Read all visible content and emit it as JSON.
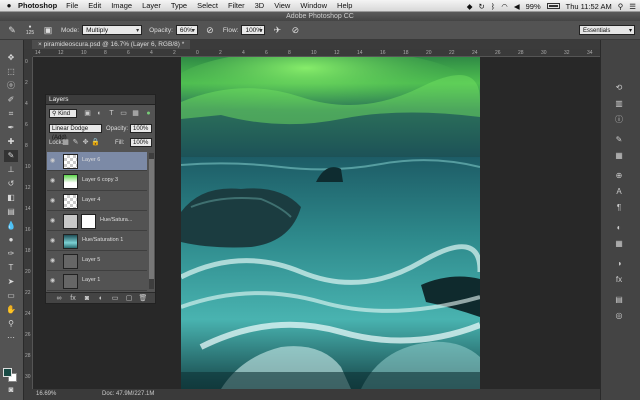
{
  "menubar": {
    "apple": "",
    "app": "Photoshop",
    "items": [
      "File",
      "Edit",
      "Image",
      "Layer",
      "Type",
      "Select",
      "Filter",
      "3D",
      "View",
      "Window",
      "Help"
    ],
    "battery": "99%",
    "clock": "Thu 11:52 AM"
  },
  "window": {
    "title": "Adobe Photoshop CC"
  },
  "options": {
    "brush_size": "125",
    "mode_label": "Mode:",
    "mode_value": "Multiply",
    "opacity_label": "Opacity:",
    "opacity_value": "60%",
    "flow_label": "Flow:",
    "flow_value": "100%",
    "workspace": "Essentials"
  },
  "document": {
    "tab": "piramideoscura.psd @ 16.7% (Layer 6, RGB/8) *",
    "zoom": "16.69%",
    "info": "Doc: 47.9M/227.1M"
  },
  "rulers": {
    "h_ticks": [
      "14",
      "12",
      "10",
      "8",
      "6",
      "4",
      "2",
      "0",
      "2",
      "4",
      "6",
      "8",
      "10",
      "12",
      "14",
      "16",
      "18",
      "20",
      "22",
      "24",
      "26",
      "28",
      "30",
      "32",
      "34"
    ],
    "v_ticks": [
      "0",
      "2",
      "4",
      "6",
      "8",
      "10",
      "12",
      "14",
      "16",
      "18",
      "20",
      "22",
      "24",
      "26",
      "28",
      "30"
    ]
  },
  "layers": {
    "panel_title": "Layers",
    "filter_value": "Kind",
    "blend_mode": "Linear Dodge (Add)",
    "opacity_label": "Opacity:",
    "opacity_value": "100%",
    "lock_label": "Lock:",
    "fill_label": "Fill:",
    "fill_value": "100%",
    "items": [
      {
        "name": "Layer 6",
        "thumb": "checker",
        "selected": true
      },
      {
        "name": "Layer 6 copy 3",
        "thumb": "green",
        "selected": false
      },
      {
        "name": "Layer 4",
        "thumb": "checker",
        "selected": false
      },
      {
        "name": "Hue/Satura...",
        "thumb": "white",
        "selected": false
      },
      {
        "name": "Hue/Saturation 1",
        "thumb": "photo",
        "selected": false
      },
      {
        "name": "Layer 5",
        "thumb": "gray",
        "selected": false
      },
      {
        "name": "Layer 1",
        "thumb": "gray",
        "selected": false
      }
    ]
  },
  "colors": {
    "foreground": "#184a44",
    "background": "#ffffff",
    "selected_layer": "#7c8aa6"
  }
}
